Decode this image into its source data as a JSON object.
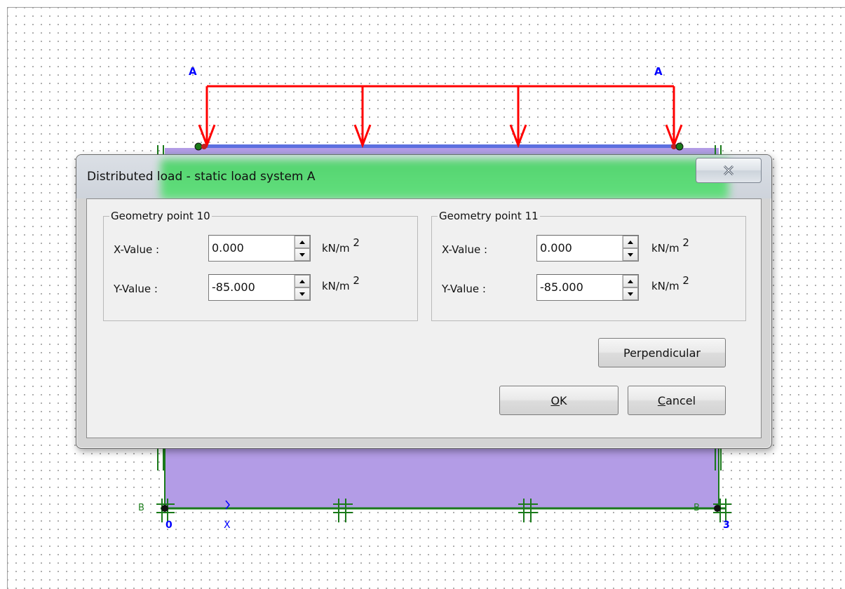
{
  "canvas": {
    "load_labels": [
      "A",
      "A"
    ],
    "node_labels": {
      "left_number": "0",
      "right_number": "3",
      "axis_label": "X",
      "left_support": "B",
      "right_support": "B"
    },
    "colors": {
      "load_arrows": "#ff0000",
      "beam_fill": "#b39ce6",
      "beam_top": "#5c6fe0",
      "support_lines": "#1a7a1a"
    }
  },
  "dialog": {
    "title": "Distributed load - static load system A",
    "close_icon": "close-icon",
    "group_left": {
      "caption": "Geometry point 10",
      "x_label": "X-Value :",
      "x_value": "0.000",
      "x_unit": "kN/m",
      "x_unit_exp": "2",
      "y_label": "Y-Value :",
      "y_value": "-85.000",
      "y_unit": "kN/m",
      "y_unit_exp": "2"
    },
    "group_right": {
      "caption": "Geometry point 11",
      "x_label": "X-Value :",
      "x_value": "0.000",
      "x_unit": "kN/m",
      "x_unit_exp": "2",
      "y_label": "Y-Value :",
      "y_value": "-85.000",
      "y_unit": "kN/m",
      "y_unit_exp": "2"
    },
    "buttons": {
      "perpendicular": "Perpendicular",
      "ok_mnemonic": "O",
      "ok_rest": "K",
      "cancel_mnemonic": "C",
      "cancel_rest": "ancel"
    }
  }
}
